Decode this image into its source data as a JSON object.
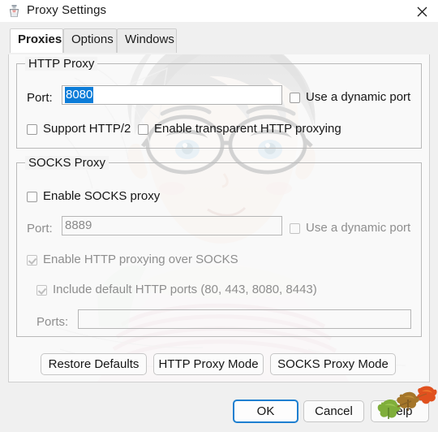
{
  "window": {
    "title": "Proxy Settings",
    "icon": "proxy-jar-icon",
    "close_icon": "close-icon",
    "bg_color": "#f0f0f0",
    "titlebar_color": "#ffffff"
  },
  "tabs": [
    {
      "label": "Proxies",
      "selected": true
    },
    {
      "label": "Options",
      "selected": false
    },
    {
      "label": "Windows",
      "selected": false
    }
  ],
  "http_proxy": {
    "group_title": "HTTP Proxy",
    "port_label": "Port:",
    "port_value": "8080",
    "port_selected": true,
    "dynamic_port": {
      "label": "Use a dynamic port",
      "checked": false,
      "enabled": true
    },
    "support_http2": {
      "label": "Support HTTP/2",
      "checked": false,
      "enabled": true
    },
    "transparent_proxying": {
      "label": "Enable transparent HTTP proxying",
      "checked": false,
      "enabled": true
    }
  },
  "socks_proxy": {
    "group_title": "SOCKS Proxy",
    "enable_socks": {
      "label": "Enable SOCKS proxy",
      "checked": false,
      "enabled": true
    },
    "port_label": "Port:",
    "port_value": "8889",
    "port_enabled": false,
    "dynamic_port": {
      "label": "Use a dynamic port",
      "checked": false,
      "enabled": false
    },
    "http_over_socks": {
      "label": "Enable HTTP proxying over SOCKS",
      "checked": true,
      "enabled": false
    },
    "include_default_ports": {
      "label": "Include default HTTP ports (80, 443, 8080, 8443)",
      "checked": true,
      "enabled": false
    },
    "ports_label": "Ports:",
    "ports_value": "",
    "ports_enabled": false
  },
  "mode_buttons": [
    {
      "label": "Restore Defaults"
    },
    {
      "label": "HTTP Proxy Mode"
    },
    {
      "label": "SOCKS Proxy Mode"
    }
  ],
  "dialog_buttons": [
    {
      "label": "OK",
      "focused": true
    },
    {
      "label": "Cancel",
      "focused": false
    },
    {
      "label": "Help",
      "focused": false
    }
  ],
  "colors": {
    "selection_blue": "#0b7cd8",
    "focus_blue": "#1d7fd0",
    "disabled_text": "#8e8e8e",
    "text": "#161616",
    "border": "#b9b9b9"
  },
  "decorations": {
    "wallpaper": "anime-character-sketch-watermark",
    "leaves": "autumn-leaves-overlay"
  }
}
